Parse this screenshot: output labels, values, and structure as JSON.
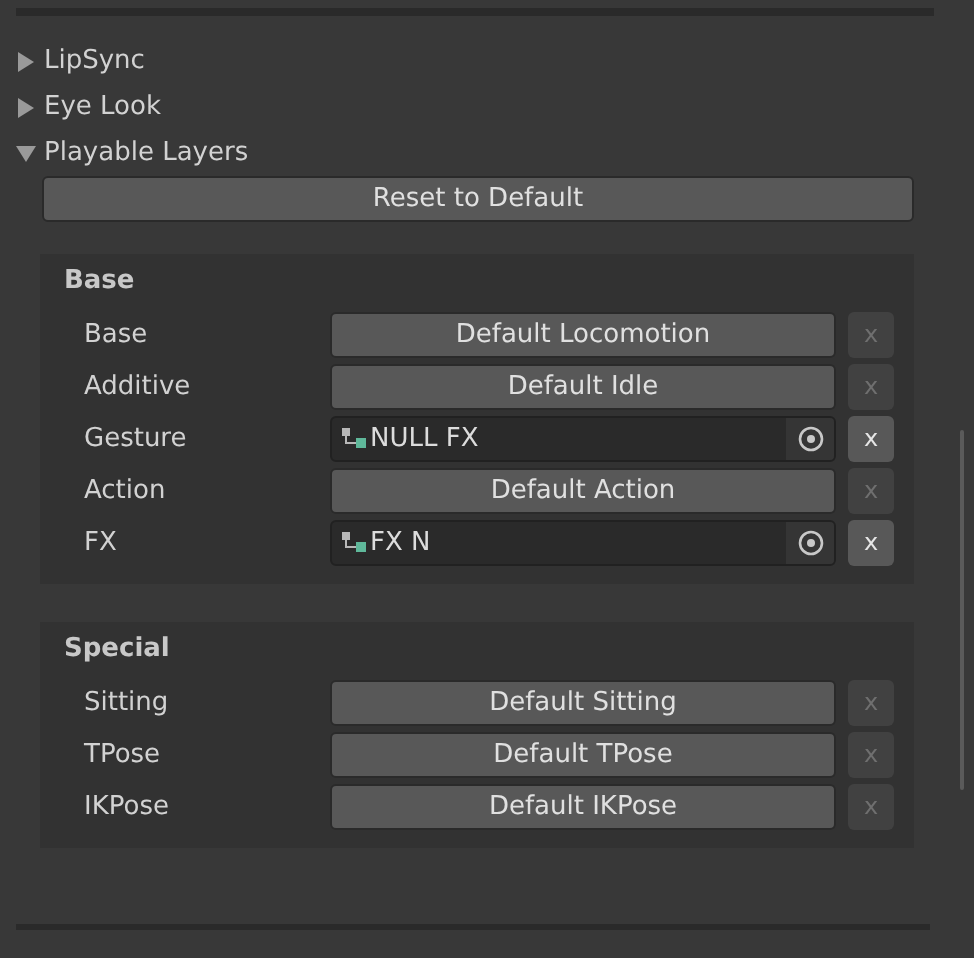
{
  "foldouts": [
    {
      "label": "LipSync",
      "expanded": false
    },
    {
      "label": "Eye Look",
      "expanded": false
    },
    {
      "label": "Playable Layers",
      "expanded": true
    }
  ],
  "reset_button": "Reset to Default",
  "sections": [
    {
      "title": "Base",
      "rows": [
        {
          "label": "Base",
          "kind": "default",
          "value": "Default Locomotion",
          "clear": "x",
          "clear_disabled": true
        },
        {
          "label": "Additive",
          "kind": "default",
          "value": "Default Idle",
          "clear": "x",
          "clear_disabled": true
        },
        {
          "label": "Gesture",
          "kind": "object",
          "value": "NULL FX",
          "clear": "x",
          "clear_disabled": false
        },
        {
          "label": "Action",
          "kind": "default",
          "value": "Default Action",
          "clear": "x",
          "clear_disabled": true
        },
        {
          "label": "FX",
          "kind": "object",
          "value": "FX N",
          "clear": "x",
          "clear_disabled": false
        }
      ]
    },
    {
      "title": "Special",
      "rows": [
        {
          "label": "Sitting",
          "kind": "default",
          "value": "Default Sitting",
          "clear": "x",
          "clear_disabled": true
        },
        {
          "label": "TPose",
          "kind": "default",
          "value": "Default TPose",
          "clear": "x",
          "clear_disabled": true
        },
        {
          "label": "IKPose",
          "kind": "default",
          "value": "Default IKPose",
          "clear": "x",
          "clear_disabled": true
        }
      ]
    }
  ]
}
